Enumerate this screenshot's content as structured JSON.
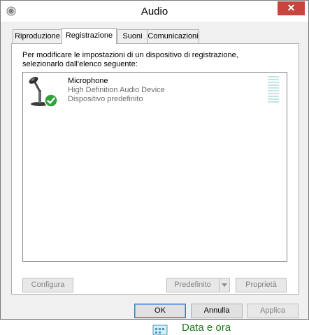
{
  "window": {
    "title": "Audio",
    "close_icon": "close-icon",
    "system_icon": "speaker-icon"
  },
  "tabs": [
    {
      "label": "Riproduzione",
      "active": false
    },
    {
      "label": "Registrazione",
      "active": true
    },
    {
      "label": "Suoni",
      "active": false
    },
    {
      "label": "Comunicazioni",
      "active": false
    }
  ],
  "panel": {
    "instructions_line1": "Per modificare le impostazioni di un dispositivo di registrazione,",
    "instructions_line2": "selezionarlo dall'elenco seguente:",
    "devices": [
      {
        "name": "Microphone",
        "description": "High Definition Audio Device",
        "status": "Dispositivo predefinito",
        "icon": "microphone-icon",
        "badge": "default-checkmark-icon"
      }
    ],
    "buttons": {
      "configure": "Configura",
      "set_default": "Predefinito",
      "properties": "Proprietà"
    }
  },
  "dialog_buttons": {
    "ok": "OK",
    "cancel": "Annulla",
    "apply": "Applica"
  },
  "background": {
    "partial_text": "Data e ora"
  },
  "colors": {
    "close": "#c7453d",
    "check": "#2fa33a",
    "meter": "#c4e3e6"
  }
}
